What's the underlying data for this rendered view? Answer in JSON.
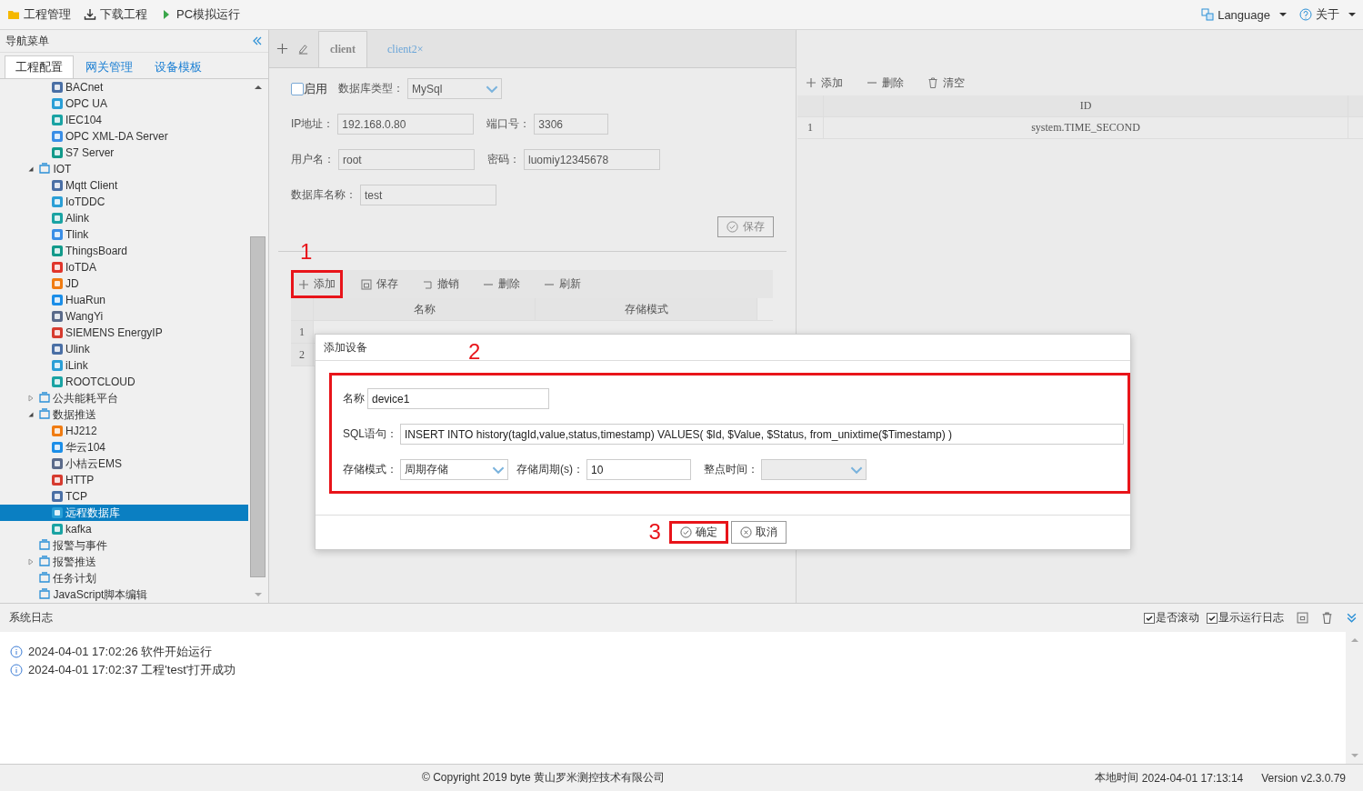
{
  "toolbar": {
    "items": [
      {
        "label": "工程管理",
        "kind": "folder"
      },
      {
        "label": "下载工程",
        "kind": "download"
      },
      {
        "label": "PC模拟运行",
        "kind": "run"
      }
    ],
    "language": "Language",
    "about": "关于"
  },
  "sidebar": {
    "title": "导航菜单",
    "tabs": [
      {
        "label": "工程配置",
        "selected": true
      },
      {
        "label": "网关管理",
        "selected": false
      },
      {
        "label": "设备模板",
        "selected": false
      }
    ],
    "tree": {
      "scrolled_children": [
        {
          "label": "BACnet",
          "selected": false
        },
        {
          "label": "OPC UA",
          "selected": false
        },
        {
          "label": "IEC104",
          "selected": false
        },
        {
          "label": "OPC XML-DA Server",
          "selected": false
        },
        {
          "label": "S7 Server",
          "selected": false
        }
      ],
      "items": [
        {
          "label": "IOT",
          "expanded": true,
          "selected": false,
          "children": [
            {
              "label": "Mqtt Client",
              "selected": false
            },
            {
              "label": "IoTDDC",
              "selected": false
            },
            {
              "label": "Alink",
              "selected": false
            },
            {
              "label": "Tlink",
              "selected": false
            },
            {
              "label": "ThingsBoard",
              "selected": false
            },
            {
              "label": "IoTDA",
              "selected": false
            },
            {
              "label": "JD",
              "selected": false
            },
            {
              "label": "HuaRun",
              "selected": false
            },
            {
              "label": "WangYi",
              "selected": false
            },
            {
              "label": "SIEMENS EnergyIP",
              "selected": false
            },
            {
              "label": "Ulink",
              "selected": false
            },
            {
              "label": "iLink",
              "selected": false
            },
            {
              "label": "ROOTCLOUD",
              "selected": false
            }
          ]
        },
        {
          "label": "公共能耗平台",
          "expanded": false,
          "selected": false
        },
        {
          "label": "数据推送",
          "expanded": true,
          "selected": false,
          "children": [
            {
              "label": "HJ212",
              "selected": false
            },
            {
              "label": "华云104",
              "selected": false
            },
            {
              "label": "小桔云EMS",
              "selected": false
            },
            {
              "label": "HTTP",
              "selected": false
            },
            {
              "label": "TCP",
              "selected": false
            },
            {
              "label": "远程数据库",
              "selected": true
            },
            {
              "label": "kafka",
              "selected": false
            }
          ]
        },
        {
          "label": "报警与事件",
          "selected": false
        },
        {
          "label": "报警推送",
          "expanded": false,
          "selected": false
        },
        {
          "label": "任务计划",
          "selected": false
        },
        {
          "label": "JavaScript脚本编辑",
          "selected": false
        }
      ]
    }
  },
  "editor": {
    "tabs": [
      {
        "label": "client",
        "selected": true
      },
      {
        "label": "client2",
        "selected": false,
        "close_glyph": "×"
      }
    ],
    "db_form": {
      "enabled": {
        "label": "启用",
        "checked": false
      },
      "db_type": {
        "label": "数据库类型：",
        "value": "MySql"
      },
      "rows": [
        [
          {
            "label": "IP地址：",
            "value": "192.168.0.80"
          },
          {
            "label": "端口号：",
            "value": "3306"
          }
        ],
        [
          {
            "label": "用户名：",
            "value": "root"
          },
          {
            "label": "密码：",
            "value": "luomiy12345678"
          }
        ],
        [
          {
            "label": "数据库名称：",
            "value": "test"
          }
        ]
      ],
      "save": "保存"
    },
    "device_grid": {
      "toolbar": [
        {
          "label": "添加",
          "kind": "add",
          "highlighted": true,
          "callout": "1"
        },
        {
          "label": "保存",
          "kind": "save",
          "highlighted": false
        },
        {
          "label": "撤销",
          "kind": "undo",
          "highlighted": false
        },
        {
          "label": "删除",
          "kind": "remove",
          "highlighted": false
        },
        {
          "label": "刷新",
          "kind": "remove",
          "highlighted": false
        }
      ],
      "columns": [
        "名称",
        "存储模式"
      ],
      "row_numbers": [
        "1",
        "2"
      ]
    }
  },
  "dialog": {
    "title": "添加设备",
    "form": {
      "highlighted": true,
      "callout": "2",
      "name": {
        "label": "名称",
        "value": "device1"
      },
      "sql": {
        "label": "SQL语句：",
        "value": "INSERT INTO history(tagId,value,status,timestamp) VALUES( $Id, $Value, $Status, from_unixtime($Timestamp) )"
      },
      "mode": {
        "label": "存储模式：",
        "value": "周期存储"
      },
      "period": {
        "label": "存储周期(s)：",
        "value": "10"
      },
      "hour_time": {
        "label": "整点时间：",
        "disabled": true
      }
    },
    "buttons": [
      {
        "label": "确定",
        "kind": "ok",
        "highlighted": true,
        "callout": "3"
      },
      {
        "label": "取消",
        "kind": "cancel",
        "highlighted": false
      }
    ]
  },
  "tags_panel": {
    "toolbar": [
      {
        "label": "添加",
        "kind": "add"
      },
      {
        "label": "删除",
        "kind": "remove"
      },
      {
        "label": "清空",
        "kind": "clear"
      }
    ],
    "columns": [
      "ID"
    ],
    "rows": [
      {
        "number": "1",
        "id": "system.TIME_SECOND"
      }
    ]
  },
  "log": {
    "title": "系统日志",
    "options": [
      {
        "label": "是否滚动",
        "checked": true
      },
      {
        "label": "显示运行日志",
        "checked": true
      }
    ],
    "entries": [
      "2024-04-01 17:02:26 软件开始运行",
      "2024-04-01 17:02:37 工程'test'打开成功"
    ]
  },
  "status_bar": {
    "copyright": "© Copyright 2019 byte 黄山罗米测控技术有限公司",
    "local_time_label": "本地时间",
    "local_time": "2024-04-01 17:13:14",
    "version": "Version v2.3.0.79"
  }
}
